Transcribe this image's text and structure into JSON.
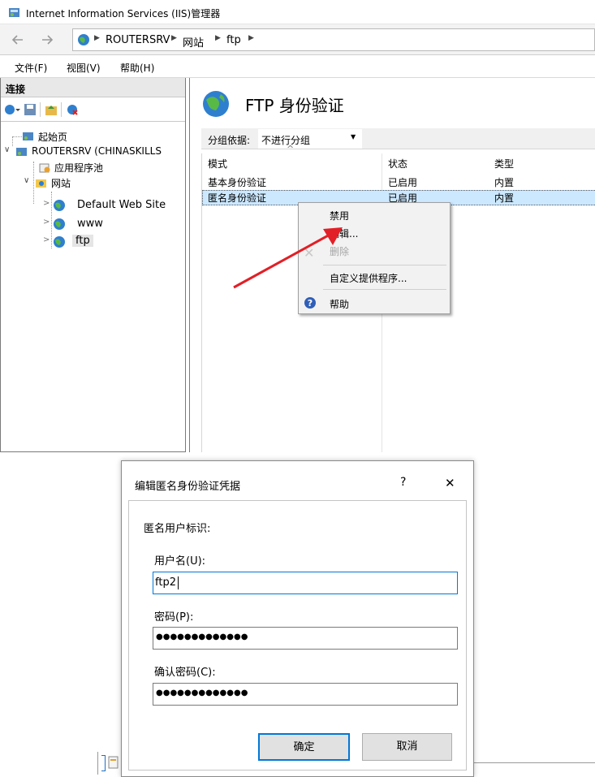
{
  "window": {
    "title": "Internet Information Services (IIS)管理器"
  },
  "address": {
    "crumbs": [
      "ROUTERSRV",
      "网站",
      "ftp"
    ]
  },
  "menu": {
    "items": [
      "文件(F)",
      "视图(V)",
      "帮助(H)"
    ]
  },
  "connections": {
    "header": "连接",
    "tree": {
      "start": "起始页",
      "server": "ROUTERSRV (CHINASKILLS",
      "apppools": "应用程序池",
      "sites": "网站",
      "site1": "Default Web Site",
      "site2": "www",
      "site3": "ftp"
    }
  },
  "feature": {
    "title": "FTP 身份验证",
    "group_label": "分组依据:",
    "group_value": "不进行分组",
    "columns": [
      "模式",
      "状态",
      "类型"
    ],
    "rows": [
      [
        "基本身份验证",
        "已启用",
        "内置"
      ],
      [
        "匿名身份验证",
        "已启用",
        "内置"
      ]
    ]
  },
  "context_menu": {
    "items": [
      "禁用",
      "编辑...",
      "删除",
      "自定义提供程序...",
      "帮助"
    ]
  },
  "dialog": {
    "title": "编辑匿名身份验证凭据",
    "help": "?",
    "close": "✕",
    "section": "匿名用户标识:",
    "username_label": "用户名(U):",
    "username_value": "ftp2",
    "password_label": "密码(P):",
    "password_value": "●●●●●●●●●●●●●",
    "confirm_label": "确认密码(C):",
    "confirm_value": "●●●●●●●●●●●●●",
    "ok": "确定",
    "cancel": "取消"
  },
  "colors": {
    "selection": "#cce8ff",
    "accent": "#0078d7",
    "arrow": "#e21f26"
  }
}
